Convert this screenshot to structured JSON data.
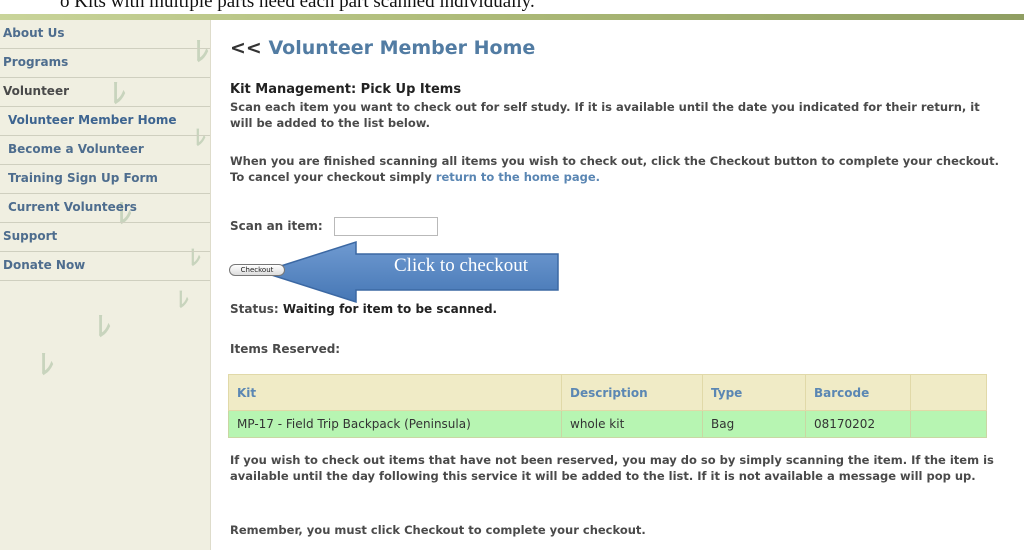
{
  "doc_header": {
    "text": "o    Kits with multiple parts need each part scanned individually."
  },
  "sidebar": {
    "items": [
      {
        "label": "About Us"
      },
      {
        "label": "Programs"
      },
      {
        "label": "Volunteer"
      },
      {
        "label": "Volunteer Member Home"
      },
      {
        "label": "Become a Volunteer"
      },
      {
        "label": "Training Sign Up Form"
      },
      {
        "label": "Current Volunteers"
      },
      {
        "label": "Support"
      },
      {
        "label": "Donate Now"
      }
    ]
  },
  "main": {
    "back_arrow": "<<",
    "page_title": "Volunteer Member Home",
    "section_title": "Kit Management: Pick Up Items",
    "intro": "Scan each item you want to check out for self study. If it is available until the date you indicated for their return, it will be added to the list below.",
    "finish_text": "When you are finished scanning all items you wish to check out, click the Checkout button to complete your checkout. To cancel your checkout simply",
    "home_link": "return to the home page.",
    "scan_label": "Scan an item:",
    "scan_value": "",
    "checkout_label": "Checkout",
    "callout": "Click to checkout",
    "status_label": "Status:",
    "status_value": "Waiting for item to be scanned.",
    "items_reserved": "Items Reserved:",
    "table": {
      "headers": [
        "Kit",
        "Description",
        "Type",
        "Barcode",
        ""
      ],
      "rows": [
        [
          "MP-17 - Field Trip Backpack (Peninsula)",
          "whole kit",
          "Bag",
          "08170202",
          ""
        ]
      ]
    },
    "note": "If you wish to check out items that have not been reserved, you may do so by simply scanning the item. If the item is available until the day following this service it will be added to the list. If it is not available a message will pop up.",
    "reminder": "Remember, you must click Checkout to complete your checkout."
  },
  "colors": {
    "link": "#527ca3",
    "table_header": "#f0ebc6",
    "table_row": "#b7f5b2",
    "callout": "#5b8cc6"
  }
}
